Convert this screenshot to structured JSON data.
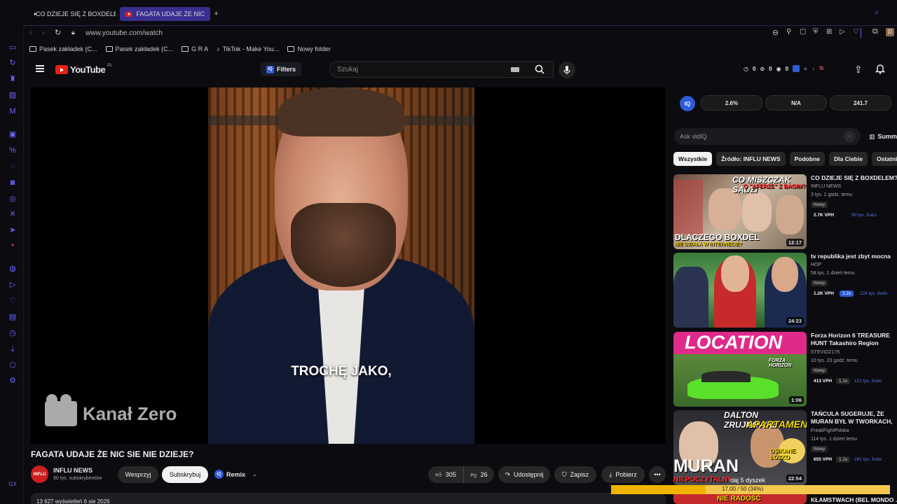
{
  "browser": {
    "tabs": [
      {
        "label": "CO DZIEJE SIĘ Z BOXDELEM",
        "active": false
      },
      {
        "label": "FAGATA UDAJE ŻE NIC",
        "active": true
      }
    ],
    "url": "www.youtube.com/watch",
    "bookmarks": [
      {
        "label": "Pasek zakładek (C...",
        "icon": "folder-icon"
      },
      {
        "label": "Pasek zakładek (C...",
        "icon": "folder-icon"
      },
      {
        "label": "G R A",
        "icon": "folder-icon"
      },
      {
        "label": "TikTok - Make You...",
        "icon": "tiktok-icon"
      },
      {
        "label": "Nowy folder",
        "icon": "folder-icon"
      }
    ],
    "profile_letter": "D"
  },
  "youtube": {
    "logo_text": "YouTube",
    "region": "PL",
    "filters_label": "Filters",
    "search_placeholder": "Szukaj",
    "counters": [
      "0",
      "0",
      "0"
    ]
  },
  "video": {
    "caption": "TROCHĘ JAKO,",
    "watermark": "Kanał Zero",
    "title": "FAGATA UDAJE ŻE NIC SIE NIE DZIEJE?",
    "channel": "INFLU NEWS",
    "channel_subs": "90 tys. subskrybentów",
    "avatar_text": "INFLU",
    "support_label": "Wesprzyj",
    "subscribe_label": "Subskrybuj",
    "remix_label": "Remix",
    "likes": "305",
    "dislikes": "26",
    "share_label": "Udostępnij",
    "save_label": "Zapisz",
    "download_label": "Pobierz",
    "views_line": "13 627 wyświetleń  6 sie 2026"
  },
  "vidiq": {
    "logo": "IQ",
    "stats": [
      "2.6%",
      "N/A",
      "241.7"
    ],
    "ask_placeholder": "Ask vidIQ",
    "summary_label": "Summ"
  },
  "chips": [
    "Wszystkie",
    "Źródło: INFLU NEWS",
    "Podobne",
    "Dla Ciebie",
    "Ostatnio"
  ],
  "recommendations": [
    {
      "title": "CO DZIEJE SIĘ Z BOXDELEM?",
      "channel": "INFLU NEWS",
      "meta": "3 tys.  1 godz. temu",
      "badge": "Nowy",
      "vph": "2.7K VPH",
      "extra": "",
      "subs": "90 tys. Subs",
      "duration": "12:17",
      "thumb_top": "CO MISZCZAK SADZI",
      "thumb_mid": "O \"AFERZE\" Z BAGIM?",
      "thumb_bottom": "DLACZEGO BOXDEL",
      "thumb_sub": "NIE DZIAŁA W INTERNECIE?"
    },
    {
      "title": "tv republika jest zbyt mocna",
      "channel": "HOP",
      "meta": "58 tys.  1 dzień temu",
      "badge": "Nowy",
      "vph": "1.2K VPH",
      "extra": "2.2x",
      "subs": "224 tys. Subs",
      "duration": "24:23"
    },
    {
      "title": "Forza Horizon 6 TREASURE HUNT Takashiro Region (Spring Festival)",
      "channel": "STEVIO2175",
      "meta": "10 tys.  23 godz. temu",
      "badge": "Nowy",
      "vph": "413 VPH",
      "extra": "1.1x",
      "subs": "121 tys. Subs",
      "duration": "1:06",
      "thumb_top": "LOCATION",
      "thumb_logo": "FORZA HORIZON"
    },
    {
      "title": "TAŃCULA SUGERUJE, ŻE MURAN BYŁ W TWORKACH, DALTON ...",
      "channel": "FreakFightPolska",
      "meta": "114 tys.  1 dzień temu",
      "badge": "Nowy",
      "vph": "655 VPH",
      "extra": "1.1x",
      "subs": "291 tys. Subs",
      "duration": "22:54",
      "thumb_top": "DALTON ZRUJNOWAŁ",
      "thumb_mid": "APARTAMENT?",
      "thumb_bottom": "MURAN",
      "thumb_sub": "NIEPOCZYTALNY",
      "thumb_right": "OSIKANE ŁÓŻKO"
    },
    {
      "title": "KŁAMSTWACH (BEL MONDO ...",
      "thumb_bottom": "NIE RADOŚĆ"
    }
  ],
  "overlay": {
    "label": "daj 5 dyszek",
    "progress_text": "17.00 / 50 (34%)",
    "progress_fraction": 0.34
  },
  "colors": {
    "accent": "#6b63ff",
    "youtube_red": "#e62117",
    "vidiq_blue": "#2e5bd6",
    "progress": "#f0b400"
  }
}
